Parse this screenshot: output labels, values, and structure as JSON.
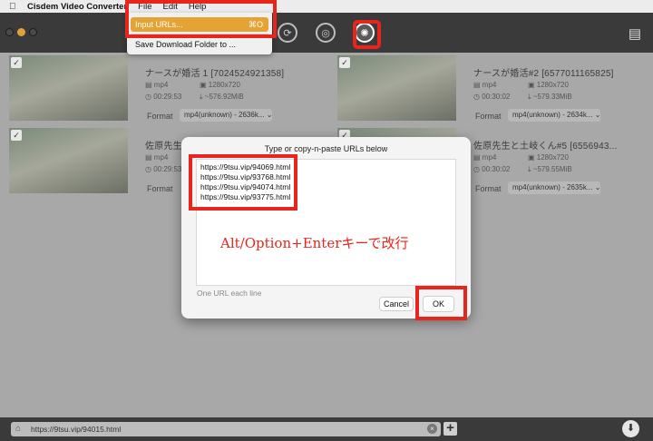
{
  "menubar": {
    "apple": "",
    "app_name": "Cisdem Video Converter",
    "menus": [
      "File",
      "Edit",
      "Help"
    ]
  },
  "file_menu": {
    "input_urls": "Input URLs...",
    "input_urls_shortcut": "⌘O",
    "save_folder": "Save Download Folder to ..."
  },
  "videos": [
    {
      "title": "ナースが婚活 1 [7024524921358]",
      "format_type": "mp4",
      "resolution": "1280x720",
      "duration": "00:29:53",
      "size": "~576.92MiB",
      "format_label": "Format",
      "format_value": "mp4(unknown) - 2636k...",
      "checked": true
    },
    {
      "title": "ナースが婚活#2 [6577011165825]",
      "format_type": "mp4",
      "resolution": "1280x720",
      "duration": "00:30:02",
      "size": "~579.33MiB",
      "format_label": "Format",
      "format_value": "mp4(unknown) - 2634k...",
      "checked": true
    },
    {
      "title": "佐原先生と",
      "format_type": "mp4",
      "resolution": "",
      "duration": "00:29:53",
      "size": "",
      "format_label": "Format",
      "format_value": "",
      "checked": true
    },
    {
      "title": "佐原先生と土岐くん#5 [6556943...",
      "format_type": "mp4",
      "resolution": "1280x720",
      "duration": "00:30:02",
      "size": "~579.55MiB",
      "format_label": "Format",
      "format_value": "mp4(unknown) - 2635k...",
      "checked": true
    }
  ],
  "dialog": {
    "title": "Type or copy-n-paste URLs below",
    "urls": [
      "https://9tsu.vip/94069.html",
      "https://9tsu.vip/93768.html",
      "https://9tsu.vip/94074.html",
      "https://9tsu.vip/93775.html"
    ],
    "hint": "One URL each line",
    "cancel": "Cancel",
    "ok": "OK"
  },
  "annotation": "Alt/Option+Enterキーで改行",
  "bottombar": {
    "url": "https://9tsu.vip/94015.html"
  },
  "colors": {
    "highlight": "#e6a335",
    "annotation_red": "#e8251c"
  }
}
